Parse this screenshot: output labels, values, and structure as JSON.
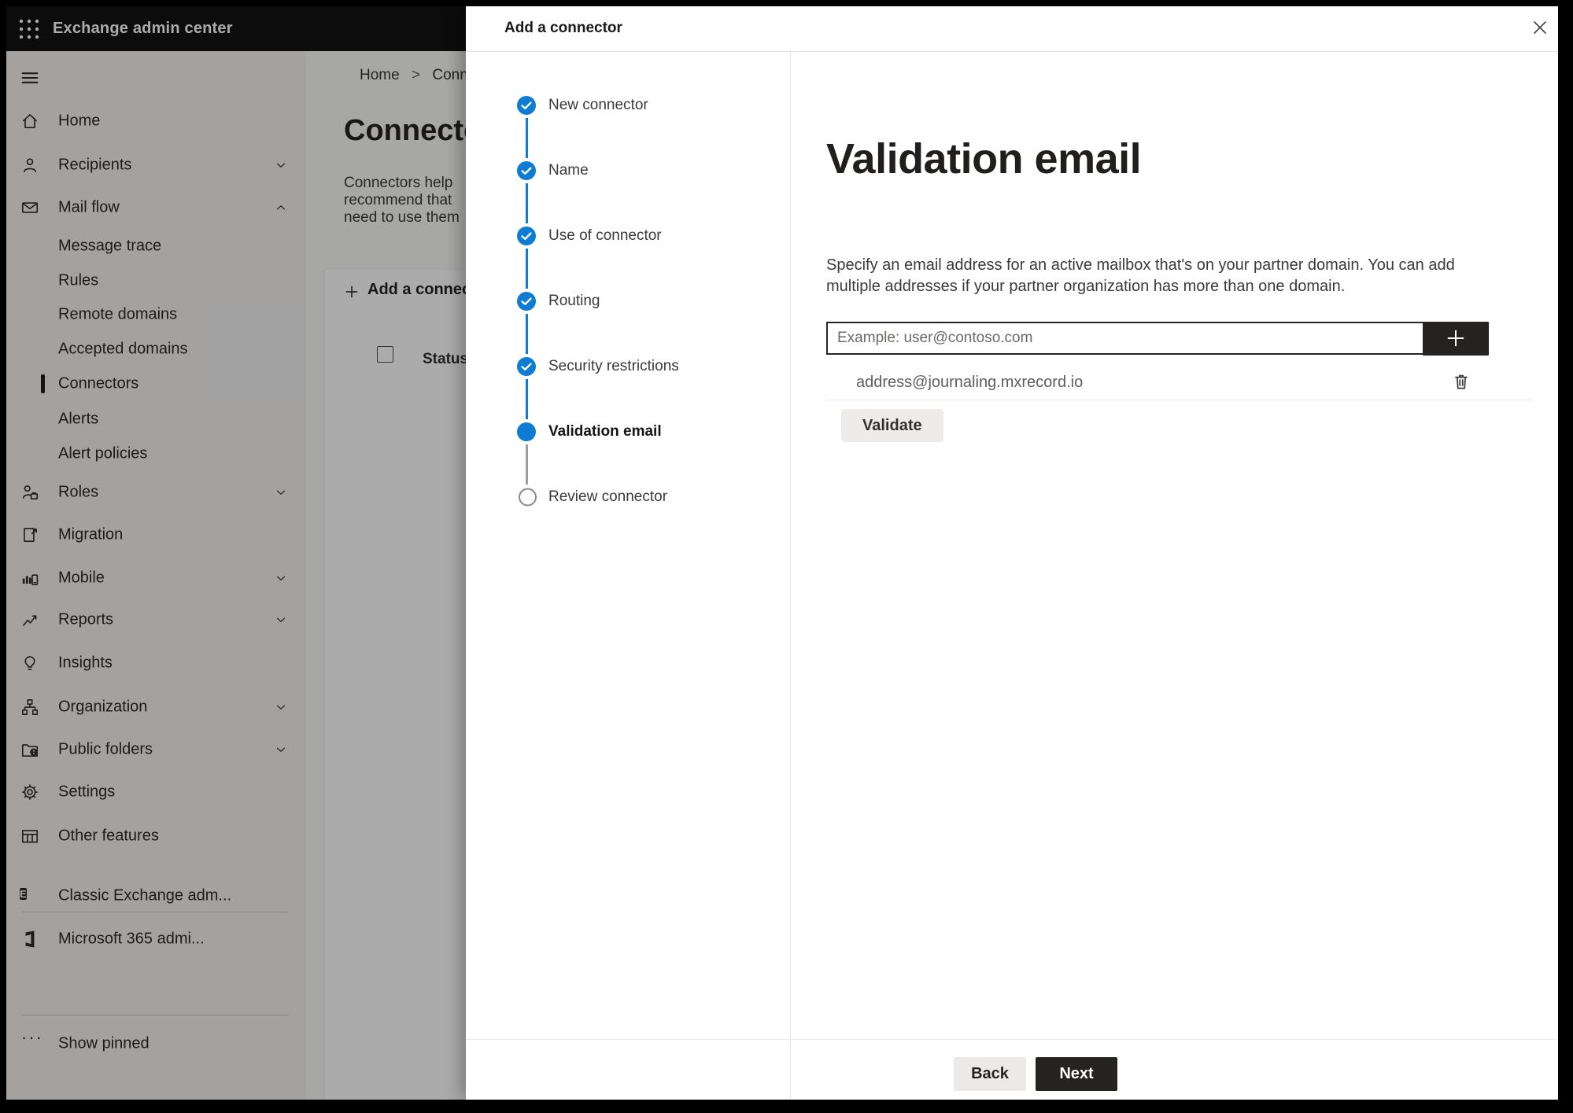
{
  "topbar": {
    "title": "Exchange admin center",
    "waffle_icon": "app-launcher-icon"
  },
  "sidebar": {
    "menu_icon": "hamburger-icon",
    "items": [
      {
        "label": "Home",
        "icon": "home"
      },
      {
        "label": "Recipients",
        "icon": "person",
        "chevron": "down"
      },
      {
        "label": "Mail flow",
        "icon": "mail",
        "chevron": "up"
      },
      {
        "label": "Message trace",
        "sub": true
      },
      {
        "label": "Rules",
        "sub": true
      },
      {
        "label": "Remote domains",
        "sub": true
      },
      {
        "label": "Accepted domains",
        "sub": true
      },
      {
        "label": "Connectors",
        "sub": true,
        "selected": true
      },
      {
        "label": "Alerts",
        "sub": true
      },
      {
        "label": "Alert policies",
        "sub": true
      },
      {
        "label": "Roles",
        "icon": "roles",
        "chevron": "down"
      },
      {
        "label": "Migration",
        "icon": "migration"
      },
      {
        "label": "Mobile",
        "icon": "mobile",
        "chevron": "down"
      },
      {
        "label": "Reports",
        "icon": "reports",
        "chevron": "down"
      },
      {
        "label": "Insights",
        "icon": "insights"
      },
      {
        "label": "Organization",
        "icon": "organization",
        "chevron": "down"
      },
      {
        "label": "Public folders",
        "icon": "public-folders",
        "chevron": "down"
      },
      {
        "label": "Settings",
        "icon": "settings"
      },
      {
        "label": "Other features",
        "icon": "other-features"
      }
    ],
    "footer_items": [
      {
        "label": "Classic Exchange adm...",
        "icon": "classic-exchange"
      },
      {
        "label": "Microsoft 365 admi...",
        "icon": "m365"
      }
    ],
    "show_pinned_label": "Show pinned"
  },
  "page": {
    "breadcrumb": {
      "home": "Home",
      "separator": ">",
      "current": "Connectors"
    },
    "title": "Connectors",
    "description_lines": [
      "Connectors help",
      "recommend that",
      "need to use them"
    ],
    "toolbar": {
      "add_label": "Add a connector"
    },
    "table": {
      "status_header": "Status",
      "sort_icon": "up-arrow"
    }
  },
  "wizard": {
    "title": "Add a connector",
    "close_icon": "close-icon",
    "steps": [
      {
        "label": "New connector",
        "state": "completed"
      },
      {
        "label": "Name",
        "state": "completed"
      },
      {
        "label": "Use of connector",
        "state": "completed"
      },
      {
        "label": "Routing",
        "state": "completed"
      },
      {
        "label": "Security restrictions",
        "state": "completed"
      },
      {
        "label": "Validation email",
        "state": "current"
      },
      {
        "label": "Review connector",
        "state": "upcoming"
      }
    ],
    "content": {
      "heading": "Validation email",
      "description_lines": [
        "Specify an email address for an active mailbox that's on your partner domain. You can add",
        "multiple addresses if your partner organization has more than one domain."
      ],
      "email_input": {
        "placeholder": "Example: user@contoso.com",
        "value": ""
      },
      "add_address_icon": "plus-icon",
      "addresses": [
        {
          "email": "address@journaling.mxrecord.io",
          "delete_icon": "trash-icon"
        }
      ],
      "validate_label": "Validate"
    },
    "footer": {
      "back_label": "Back",
      "next_label": "Next"
    }
  },
  "colors": {
    "accent_blue": "#0f7cd4",
    "step_gray": "#8a8886",
    "dark_button": "#242322",
    "topbar_black": "#141312",
    "sidebar_gray": "#f3f2f1"
  }
}
